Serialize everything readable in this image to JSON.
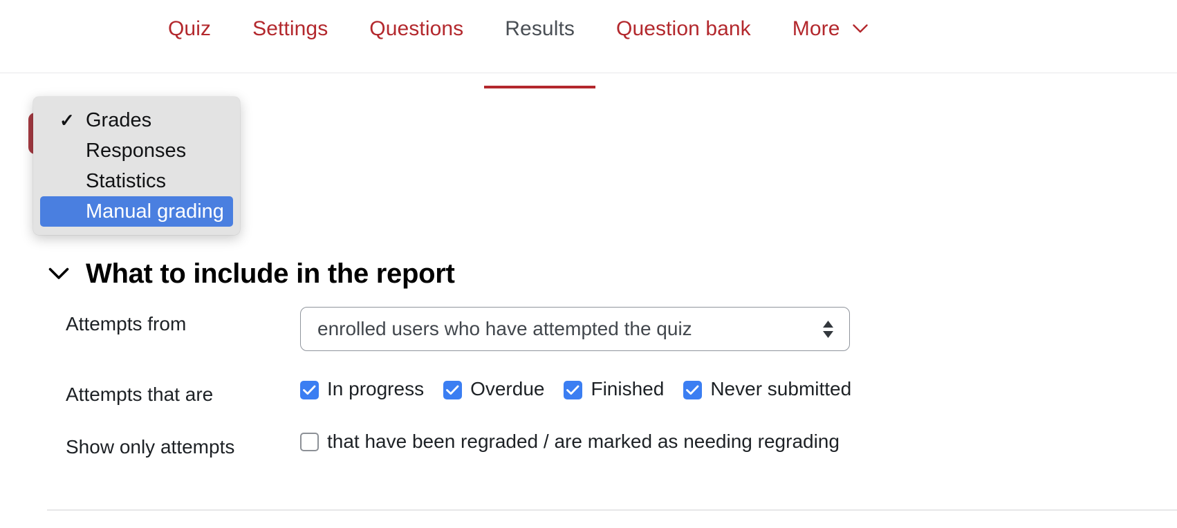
{
  "nav": {
    "tabs": [
      {
        "label": "Quiz",
        "active": false
      },
      {
        "label": "Settings",
        "active": false
      },
      {
        "label": "Questions",
        "active": false
      },
      {
        "label": "Results",
        "active": true
      },
      {
        "label": "Question bank",
        "active": false
      },
      {
        "label": "More",
        "active": false,
        "has_chevron": true
      }
    ],
    "active_tab": "Results",
    "accent_color": "#b3282d",
    "active_text_color": "#4a4f55"
  },
  "report_dropdown": {
    "icon": "select-popup",
    "highlight_color": "#4a7fe0",
    "background_color": "#e3e3e3",
    "checked_item": "Grades",
    "selected_item": "Manual grading",
    "options": [
      {
        "label": "Grades",
        "checked": true,
        "selected": false
      },
      {
        "label": "Responses",
        "checked": false,
        "selected": false
      },
      {
        "label": "Statistics",
        "checked": false,
        "selected": false
      },
      {
        "label": "Manual grading",
        "checked": false,
        "selected": true
      }
    ]
  },
  "section": {
    "title": "What to include in the report",
    "collapse_icon": "chevron-down-icon",
    "expanded": true
  },
  "form": {
    "attempts_from": {
      "label": "Attempts from",
      "value": "enrolled users who have attempted the quiz",
      "arrows_icon": "up-down-arrows-icon"
    },
    "attempts_that_are": {
      "label": "Attempts that are",
      "checkboxes": [
        {
          "label": "In progress",
          "checked": true
        },
        {
          "label": "Overdue",
          "checked": true
        },
        {
          "label": "Finished",
          "checked": true
        },
        {
          "label": "Never submitted",
          "checked": true
        }
      ]
    },
    "show_only_attempts": {
      "label": "Show only attempts",
      "checkboxes": [
        {
          "label": "that have been regraded / are marked as needing regrading",
          "checked": false
        }
      ]
    }
  }
}
